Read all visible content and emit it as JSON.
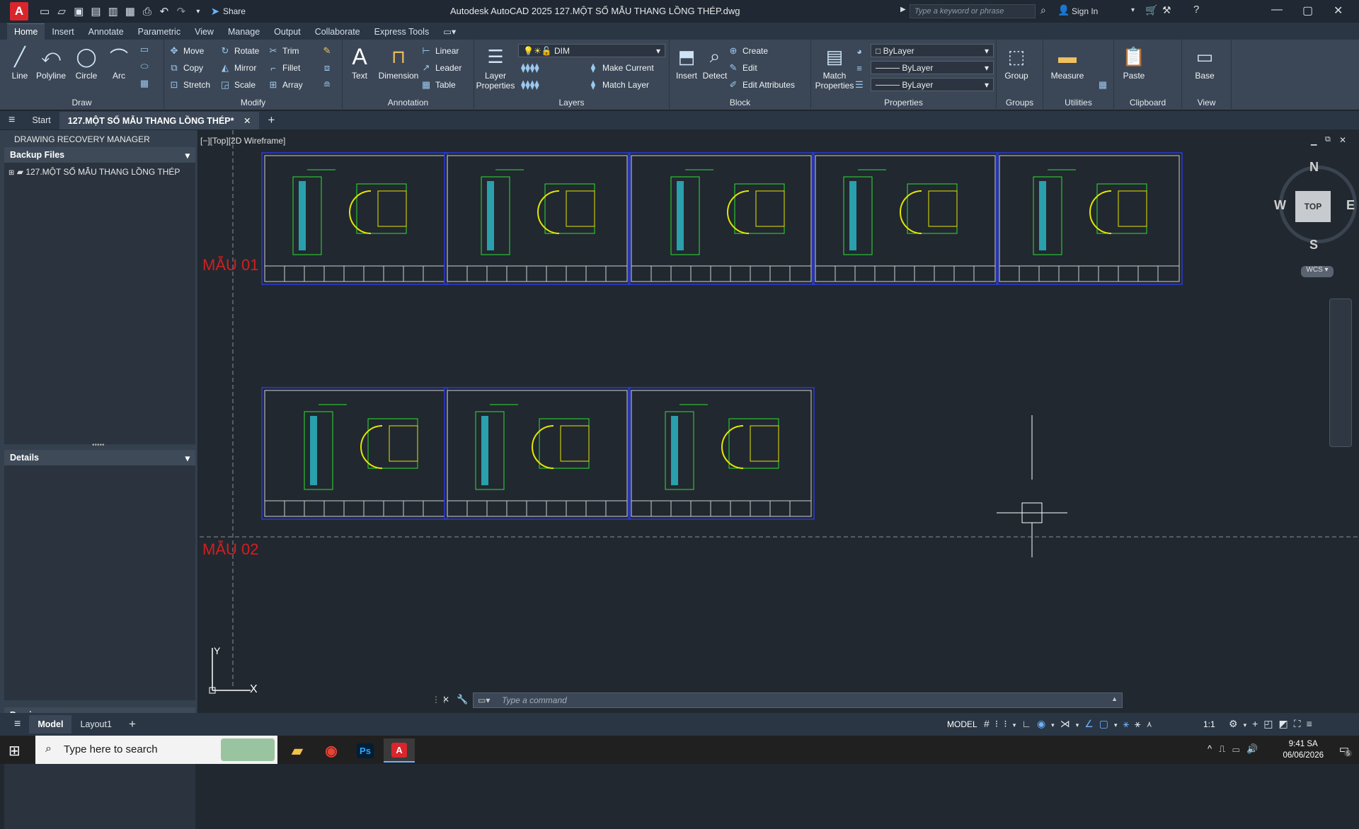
{
  "app": {
    "logo": "A",
    "title": "Autodesk AutoCAD 2025   127.MỘT SỐ MẪU THANG LỒNG THÉP.dwg",
    "share": "Share",
    "search_placeholder": "Type a keyword or phrase",
    "sign_in": "Sign In"
  },
  "ribbon_tabs": [
    "Home",
    "Insert",
    "Annotate",
    "Parametric",
    "View",
    "Manage",
    "Output",
    "Collaborate",
    "Express Tools"
  ],
  "ribbon": {
    "draw": {
      "title": "Draw",
      "line": "Line",
      "polyline": "Polyline",
      "circle": "Circle",
      "arc": "Arc"
    },
    "modify": {
      "title": "Modify",
      "move": "Move",
      "rotate": "Rotate",
      "trim": "Trim",
      "copy": "Copy",
      "mirror": "Mirror",
      "fillet": "Fillet",
      "stretch": "Stretch",
      "scale": "Scale",
      "array": "Array"
    },
    "annotation": {
      "title": "Annotation",
      "text": "Text",
      "dimension": "Dimension",
      "linear": "Linear",
      "leader": "Leader",
      "table": "Table"
    },
    "layers": {
      "title": "Layers",
      "layer_properties": "Layer Properties",
      "current_layer": "DIM",
      "make_current": "Make Current",
      "match_layer": "Match Layer"
    },
    "block": {
      "title": "Block",
      "insert": "Insert",
      "detect": "Detect",
      "create": "Create",
      "edit": "Edit",
      "edit_attributes": "Edit Attributes"
    },
    "properties": {
      "title": "Properties",
      "match_properties": "Match Properties",
      "color": "ByLayer",
      "linetype": "ByLayer",
      "lineweight": "ByLayer"
    },
    "groups": {
      "title": "Groups",
      "group": "Group"
    },
    "utilities": {
      "title": "Utilities",
      "measure": "Measure"
    },
    "clipboard": {
      "title": "Clipboard",
      "paste": "Paste"
    },
    "view": {
      "title": "View",
      "base": "Base"
    }
  },
  "file_tabs": {
    "start": "Start",
    "active": "127.MỘT SỐ MẪU THANG LỒNG THÉP*"
  },
  "palette": {
    "title": "DRAWING RECOVERY MANAGER",
    "backup_header": "Backup Files",
    "backup_item": "127.MỘT SỐ MẪU THANG LỒNG THÉP",
    "details_header": "Details",
    "preview_header": "Preview"
  },
  "viewport": {
    "label": "[−][Top][2D Wireframe]"
  },
  "drawing": {
    "row1_label": "MẪU 01",
    "row2_label": "MẪU 02"
  },
  "viewcube": {
    "n": "N",
    "s": "S",
    "e": "E",
    "w": "W",
    "top": "TOP",
    "wcs": "WCS"
  },
  "ucs": {
    "x": "X",
    "y": "Y"
  },
  "command": {
    "placeholder": "Type a command"
  },
  "status": {
    "model_tab": "Model",
    "layout_tab": "Layout1",
    "model_indicator": "MODEL",
    "scale": "1:1"
  },
  "taskbar": {
    "search": "Type here to search",
    "time": "9:41 SA",
    "date": "06/06/2026",
    "notification_count": "5"
  },
  "colors": {
    "accent": "#d9262c",
    "drawing_green": "#2fe02f",
    "drawing_yellow": "#e6e600",
    "drawing_cyan": "#2ff0ff",
    "sample_label": "#d02020"
  }
}
